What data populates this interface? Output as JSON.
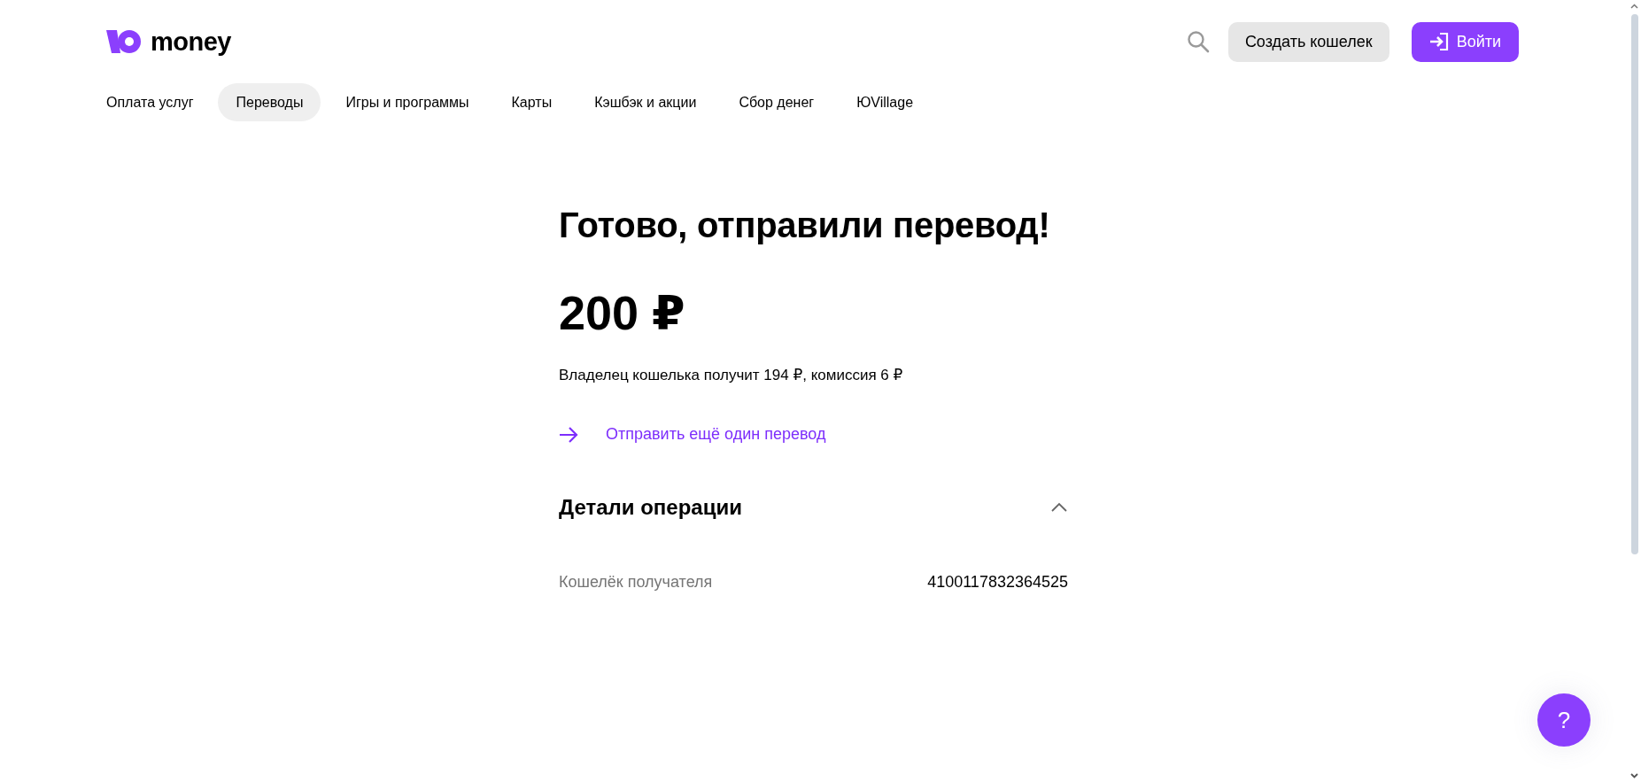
{
  "logo": {
    "text": "money"
  },
  "header_buttons": [
    {
      "kind": "secondary",
      "label": "Создать кошелек"
    },
    {
      "kind": "primary",
      "label": "Войти"
    }
  ],
  "nav": [
    {
      "label": "Оплата услуг",
      "selected": false
    },
    {
      "label": "Переводы",
      "selected": true
    },
    {
      "label": "Игры и программы",
      "selected": false
    },
    {
      "label": "Карты",
      "selected": false
    },
    {
      "label": "Кэшбэк и акции",
      "selected": false
    },
    {
      "label": "Сбор денег",
      "selected": false
    },
    {
      "label": "ЮVillage",
      "selected": false
    }
  ],
  "result": {
    "title": "Готово, отправили перевод!",
    "amount": "200 ₽",
    "note": "Владелец кошелька получит 194 ₽, комиссия 6 ₽",
    "link": "Отправить ещё один перевод"
  },
  "details": {
    "title": "Детали операции",
    "expanded": true,
    "rows": [
      {
        "label": "Кошелёк получателя",
        "value": "4100117832364525"
      }
    ]
  },
  "help_button": {
    "label": "?"
  }
}
